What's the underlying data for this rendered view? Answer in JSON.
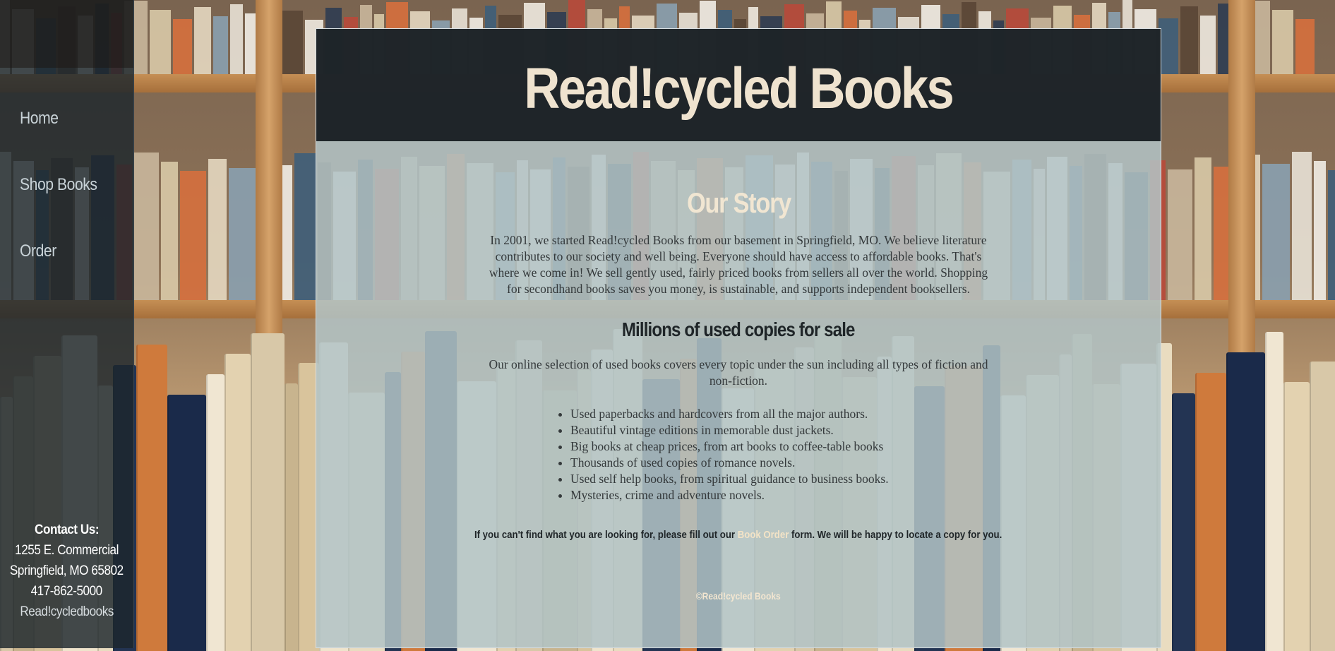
{
  "brand": {
    "title": "Read!cycled Books"
  },
  "sidebar": {
    "nav": [
      {
        "label": "Home"
      },
      {
        "label": "Shop Books"
      },
      {
        "label": "Order"
      }
    ],
    "contact": {
      "heading": "Contact Us:",
      "address1": "1255 E. Commercial",
      "address2": "Springfield, MO 65802",
      "phone": "417-862-5000",
      "link": "Read!cycledbooks"
    }
  },
  "main": {
    "story_heading": "Our Story",
    "story_text": "In 2001, we started Read!cycled Books from our basement in Springfield, MO. We believe literature contributes to our society and well being. Everyone should have access to affordable books. That's where we come in! We sell gently used, fairly priced books from sellers all over the world. Shopping for secondhand books saves you money, is sustainable, and supports independent booksellers.",
    "sub_heading": "Millions of used copies for sale",
    "selection_text": "Our online selection of used books covers every topic under the sun including all types of fiction and non-fiction.",
    "features": [
      "Used paperbacks and hardcovers from all the major authors.",
      "Beautiful vintage editions in memorable dust jackets.",
      "Big books at cheap prices, from art books to coffee-table books",
      "Thousands of used copies of romance novels.",
      "Used self help books, from spiritual guidance to business books.",
      "Mysteries, crime and adventure novels."
    ],
    "note_before": "If you can't find what you are looking for, please fill out our ",
    "note_link": "Book Order",
    "note_after": " form. We will be happy to locate a copy for you.",
    "footer": "©Read!cycled Books"
  },
  "colors": {
    "accent": "#efe3cf",
    "sidebar_bg": "#1c262c",
    "masthead_bg": "#141a1e",
    "panel_bg": "#b2c4c6"
  }
}
